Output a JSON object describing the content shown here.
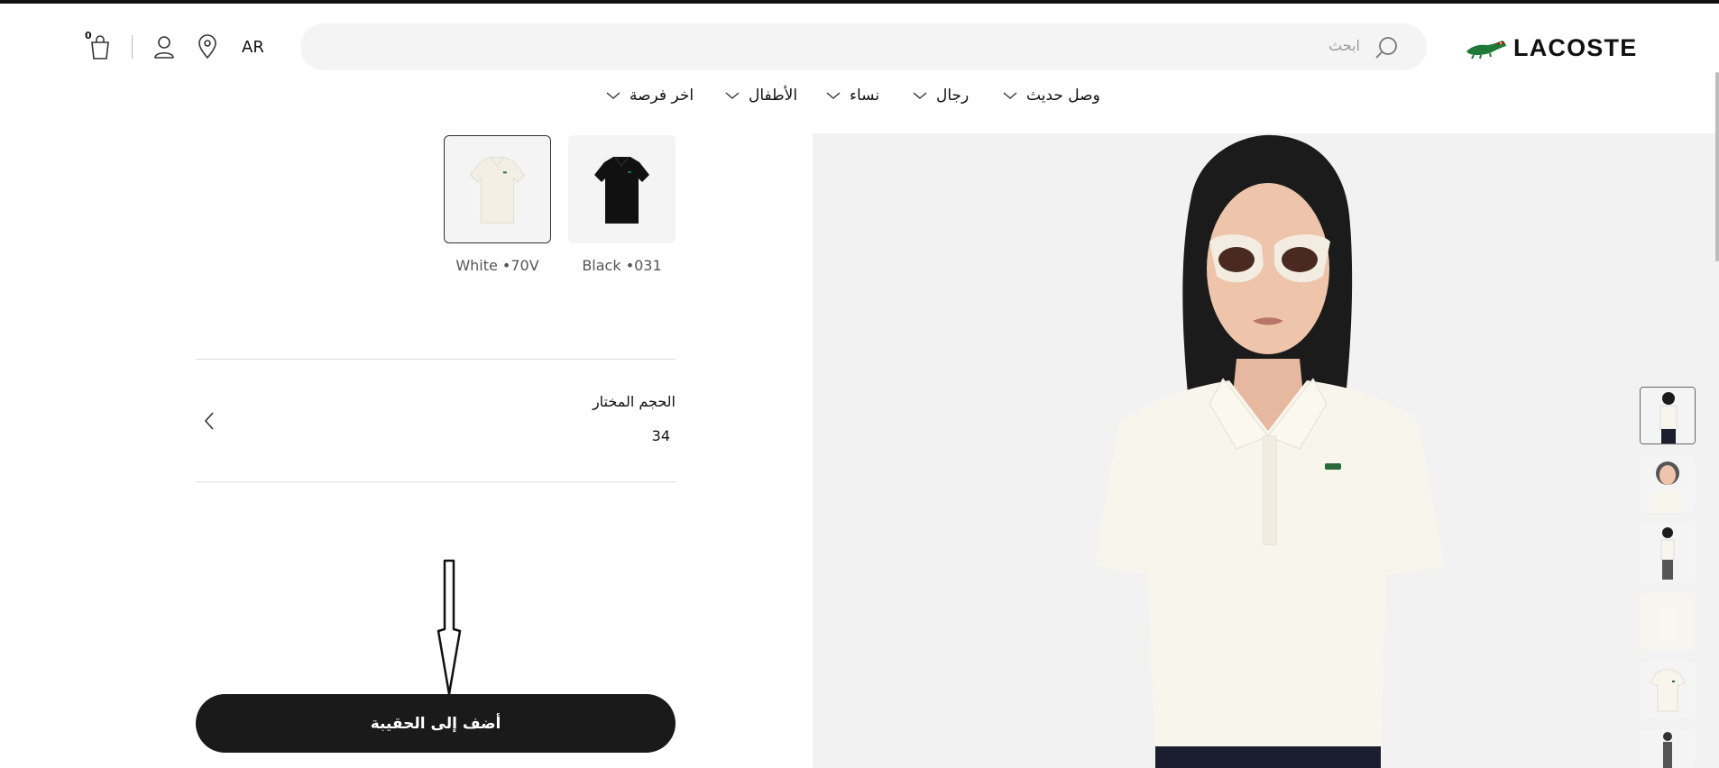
{
  "header": {
    "logo_text": "LACOSTE",
    "search_placeholder": "ابحث",
    "language": "AR",
    "bag_count": "0"
  },
  "nav": [
    {
      "label": "وصل حديث"
    },
    {
      "label": "رجال"
    },
    {
      "label": "نساء"
    },
    {
      "label": "الأطفال"
    },
    {
      "label": "اخر فرصة"
    }
  ],
  "colors": [
    {
      "label": "White •70V",
      "swatch": "#f3efe4",
      "selected": true
    },
    {
      "label": "Black •031",
      "swatch": "#111111",
      "selected": false
    }
  ],
  "size": {
    "title": "الحجم المختار",
    "value": "34"
  },
  "add_to_bag_label": "أضف إلى الحقيبة",
  "icons": {
    "search": "search-icon",
    "bag": "shopping-bag-icon",
    "account": "user-icon",
    "store": "location-pin-icon",
    "size_chevron": "chevron-left-icon",
    "nav_chevron": "chevron-down-icon"
  },
  "accent": {
    "button": "#1a1a1a",
    "logo_green": "#1f7a3a"
  }
}
